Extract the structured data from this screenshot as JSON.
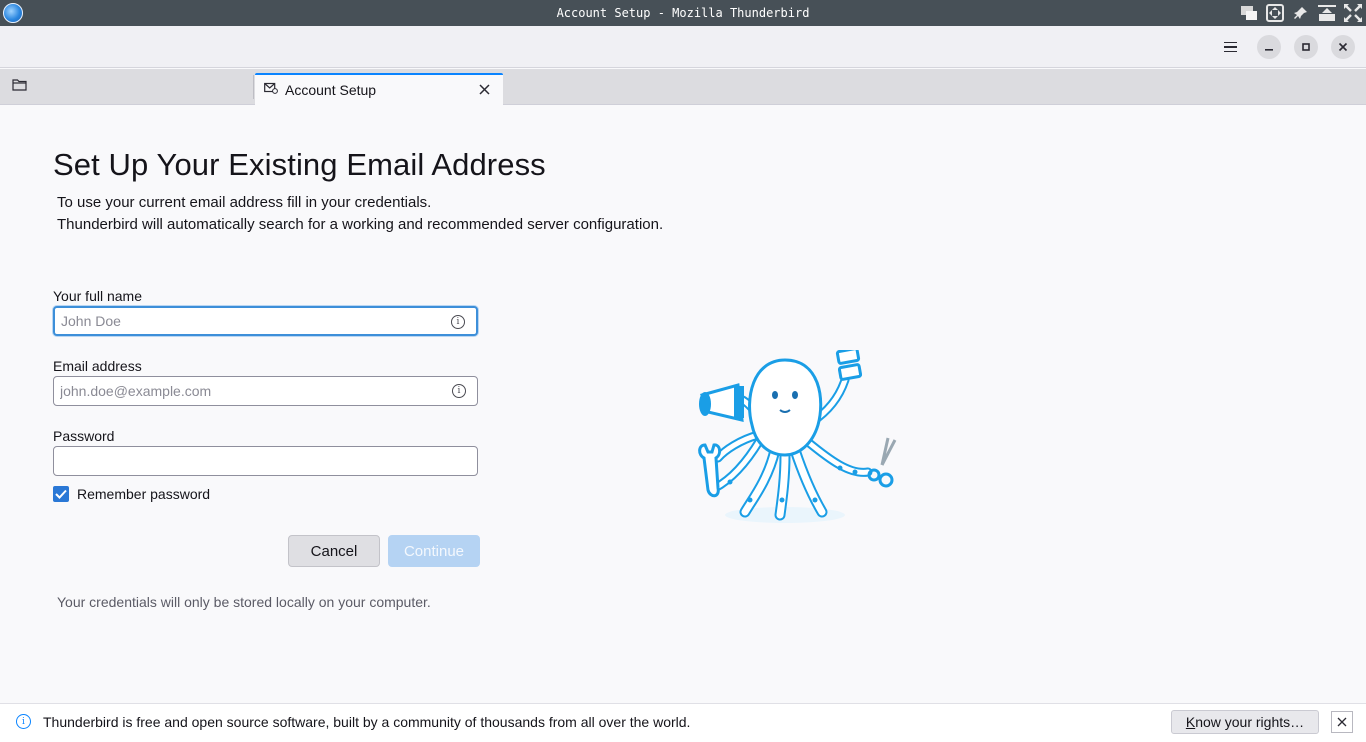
{
  "window": {
    "title": "Account Setup - Mozilla Thunderbird"
  },
  "tabs": [
    {
      "label": "",
      "icon": "folder-icon"
    },
    {
      "label": "Account Setup",
      "icon": "mail-setup-icon"
    }
  ],
  "page": {
    "title": "Set Up Your Existing Email Address",
    "description_line1": "To use your current email address fill in your credentials.",
    "description_line2": "Thunderbird will automatically search for a working and recommended server configuration."
  },
  "form": {
    "full_name": {
      "label": "Your full name",
      "placeholder": "John Doe",
      "value": ""
    },
    "email": {
      "label": "Email address",
      "placeholder": "john.doe@example.com",
      "value": ""
    },
    "password": {
      "label": "Password",
      "value": ""
    },
    "remember": {
      "label": "Remember password",
      "checked": true
    },
    "cancel_label": "Cancel",
    "continue_label": "Continue",
    "local_note": "Your credentials will only be stored locally on your computer."
  },
  "notification": {
    "text": "Thunderbird is free and open source software, built by a community of thousands from all over the world.",
    "button_first_letter": "K",
    "button_rest": "now your rights…"
  },
  "colors": {
    "accent": "#0a84ff",
    "checkbox": "#2a78d6",
    "illustration_blue": "#1a9ee6",
    "continue_disabled": "#b5d3f3"
  }
}
